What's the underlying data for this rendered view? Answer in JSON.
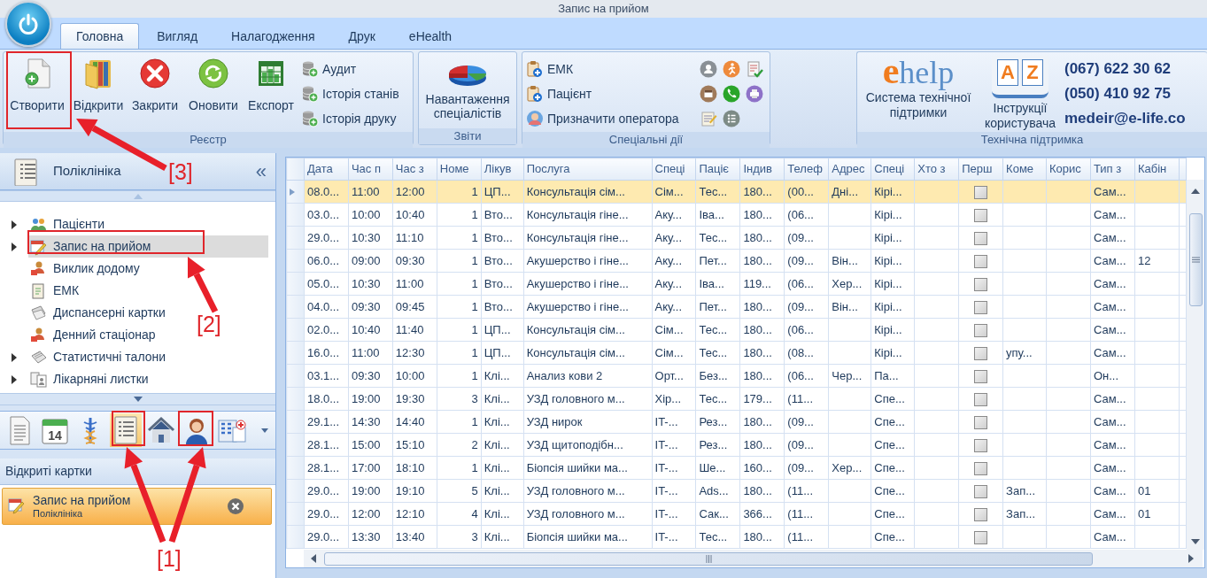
{
  "window": {
    "title": "Запис на прийом"
  },
  "tabs": [
    {
      "label": "Головна",
      "selected": true
    },
    {
      "label": "Вигляд",
      "selected": false
    },
    {
      "label": "Налагодження",
      "selected": false
    },
    {
      "label": "Друк",
      "selected": false
    },
    {
      "label": "eHealth",
      "selected": false
    }
  ],
  "ribbon": {
    "registry": {
      "caption": "Реєстр",
      "large_buttons": [
        "Створити",
        "Відкрити",
        "Закрити",
        "Оновити",
        "Експорт"
      ],
      "small_buttons": [
        "Аудит",
        "Історія станів",
        "Історія друку"
      ]
    },
    "reports": {
      "caption": "Звіти",
      "large_buttons": [
        "Навантаження спеціалістів"
      ]
    },
    "special_actions": {
      "caption": "Спеціальні дії",
      "small_buttons": [
        "ЕМК",
        "Пацієнт",
        "Призначити оператора"
      ]
    },
    "support": {
      "caption": "Технічна підтримка",
      "help_logo": "ehelp",
      "help_label": "Система технічної підтримки",
      "manual_letters": [
        "A",
        "Z"
      ],
      "manual_label": "Інструкції користувача",
      "contacts": [
        "(067) 622 30 62",
        "(050) 410 92 75",
        "medeir@e-life.co"
      ]
    }
  },
  "left_panel": {
    "title": "Поліклініка",
    "collapse": "«",
    "tree": [
      {
        "label": "Пацієнти",
        "expandable": true,
        "selected": false
      },
      {
        "label": "Запис на прийом",
        "expandable": true,
        "selected": true
      },
      {
        "label": "Виклик додому",
        "expandable": false,
        "selected": false
      },
      {
        "label": "ЕМК",
        "expandable": false,
        "selected": false
      },
      {
        "label": "Диспансерні картки",
        "expandable": false,
        "selected": false
      },
      {
        "label": "Денний стаціонар",
        "expandable": false,
        "selected": false
      },
      {
        "label": "Статистичні талони",
        "expandable": true,
        "selected": false
      },
      {
        "label": "Лікарняні листки",
        "expandable": true,
        "selected": false
      }
    ],
    "nav_icons": [
      {
        "selected": false
      },
      {
        "selected": false,
        "text": "14"
      },
      {
        "selected": false
      },
      {
        "selected": true
      },
      {
        "selected": false
      },
      {
        "selected": false
      },
      {
        "selected": false
      }
    ],
    "open_cards_title": "Відкриті картки",
    "open_cards": [
      {
        "title": "Запис на прийом",
        "subtitle": "Поліклініка"
      }
    ]
  },
  "grid": {
    "columns": [
      {
        "label": "Дата",
        "kind": "text"
      },
      {
        "label": "Час п",
        "kind": "text"
      },
      {
        "label": "Час з",
        "kind": "text"
      },
      {
        "label": "Номе",
        "kind": "number"
      },
      {
        "label": "Лікув",
        "kind": "text"
      },
      {
        "label": "Послуга",
        "kind": "text"
      },
      {
        "label": "Спеці",
        "kind": "text"
      },
      {
        "label": "Паціє",
        "kind": "text"
      },
      {
        "label": "Індив",
        "kind": "text"
      },
      {
        "label": "Телеф",
        "kind": "text"
      },
      {
        "label": "Адрес",
        "kind": "text"
      },
      {
        "label": "Спеці",
        "kind": "text"
      },
      {
        "label": "Хто з",
        "kind": "text"
      },
      {
        "label": "Перш",
        "kind": "check"
      },
      {
        "label": "Коме",
        "kind": "text"
      },
      {
        "label": "Корис",
        "kind": "text"
      },
      {
        "label": "Тип з",
        "kind": "text"
      },
      {
        "label": "Кабін",
        "kind": "text"
      }
    ],
    "rows": [
      {
        "selected": true,
        "checked": false,
        "cells": [
          "08.0...",
          "11:00",
          "12:00",
          "1",
          "ЦП...",
          "Консультація сім...",
          "Сім...",
          "Тес...",
          "180...",
          "(00...",
          "Дні...",
          "Кірі...",
          null,
          null,
          null,
          null,
          "Сам...",
          null
        ]
      },
      {
        "selected": false,
        "checked": false,
        "cells": [
          "03.0...",
          "10:00",
          "10:40",
          "1",
          "Вто...",
          "Консультація гіне...",
          "Аку...",
          "Іва...",
          "180...",
          "(06...",
          null,
          "Кірі...",
          null,
          null,
          null,
          null,
          "Сам...",
          null
        ]
      },
      {
        "selected": false,
        "checked": false,
        "cells": [
          "29.0...",
          "10:30",
          "11:10",
          "1",
          "Вто...",
          "Консультація гіне...",
          "Аку...",
          "Тес...",
          "180...",
          "(09...",
          null,
          "Кірі...",
          null,
          null,
          null,
          null,
          "Сам...",
          null
        ]
      },
      {
        "selected": false,
        "checked": false,
        "cells": [
          "06.0...",
          "09:00",
          "09:30",
          "1",
          "Вто...",
          "Акушерство і гіне...",
          "Аку...",
          "Пет...",
          "180...",
          "(09...",
          "Він...",
          "Кірі...",
          null,
          null,
          null,
          null,
          "Сам...",
          "12"
        ]
      },
      {
        "selected": false,
        "checked": false,
        "cells": [
          "05.0...",
          "10:30",
          "11:00",
          "1",
          "Вто...",
          "Акушерство і гіне...",
          "Аку...",
          "Іва...",
          "119...",
          "(06...",
          "Хер...",
          "Кірі...",
          null,
          null,
          null,
          null,
          "Сам...",
          null
        ]
      },
      {
        "selected": false,
        "checked": false,
        "cells": [
          "04.0...",
          "09:30",
          "09:45",
          "1",
          "Вто...",
          "Акушерство і гіне...",
          "Аку...",
          "Пет...",
          "180...",
          "(09...",
          "Він...",
          "Кірі...",
          null,
          null,
          null,
          null,
          "Сам...",
          null
        ]
      },
      {
        "selected": false,
        "checked": false,
        "cells": [
          "02.0...",
          "10:40",
          "11:40",
          "1",
          "ЦП...",
          "Консультація сім...",
          "Сім...",
          "Тес...",
          "180...",
          "(06...",
          null,
          "Кірі...",
          null,
          null,
          null,
          null,
          "Сам...",
          null
        ]
      },
      {
        "selected": false,
        "checked": false,
        "cells": [
          "16.0...",
          "11:00",
          "12:30",
          "1",
          "ЦП...",
          "Консультація сім...",
          "Сім...",
          "Тес...",
          "180...",
          "(08...",
          null,
          "Кірі...",
          null,
          null,
          "упу...",
          null,
          "Сам...",
          null
        ]
      },
      {
        "selected": false,
        "checked": false,
        "cells": [
          "03.1...",
          "09:30",
          "10:00",
          "1",
          "Клі...",
          "Анализ кови 2",
          "Орт...",
          "Без...",
          "180...",
          "(06...",
          "Чер...",
          "Па...",
          null,
          null,
          null,
          null,
          "Он...",
          null
        ]
      },
      {
        "selected": false,
        "checked": false,
        "cells": [
          "18.0...",
          "19:00",
          "19:30",
          "3",
          "Клі...",
          "УЗД головного м...",
          "Хір...",
          "Тес...",
          "179...",
          "(11...",
          null,
          "Спе...",
          null,
          null,
          null,
          null,
          "Сам...",
          null
        ]
      },
      {
        "selected": false,
        "checked": false,
        "cells": [
          "29.1...",
          "14:30",
          "14:40",
          "1",
          "Клі...",
          "УЗД нирок",
          "IT-...",
          "Рез...",
          "180...",
          "(09...",
          null,
          "Спе...",
          null,
          null,
          null,
          null,
          "Сам...",
          null
        ]
      },
      {
        "selected": false,
        "checked": false,
        "cells": [
          "28.1...",
          "15:00",
          "15:10",
          "2",
          "Клі...",
          "УЗД щитоподібн...",
          "IT-...",
          "Рез...",
          "180...",
          "(09...",
          null,
          "Спе...",
          null,
          null,
          null,
          null,
          "Сам...",
          null
        ]
      },
      {
        "selected": false,
        "checked": false,
        "cells": [
          "28.1...",
          "17:00",
          "18:10",
          "1",
          "Клі...",
          "Біопсія шийки ма...",
          "IT-...",
          "Ше...",
          "160...",
          "(09...",
          "Хер...",
          "Спе...",
          null,
          null,
          null,
          null,
          "Сам...",
          null
        ]
      },
      {
        "selected": false,
        "checked": false,
        "cells": [
          "29.0...",
          "19:00",
          "19:10",
          "5",
          "Клі...",
          "УЗД головного м...",
          "IT-...",
          "Ads...",
          "180...",
          "(11...",
          null,
          "Спе...",
          null,
          null,
          "Зап...",
          null,
          "Сам...",
          "01"
        ]
      },
      {
        "selected": false,
        "checked": false,
        "cells": [
          "29.0...",
          "12:00",
          "12:10",
          "4",
          "Клі...",
          "УЗД головного м...",
          "IT-...",
          "Сак...",
          "366...",
          "(11...",
          null,
          "Спе...",
          null,
          null,
          "Зап...",
          null,
          "Сам...",
          "01"
        ]
      },
      {
        "selected": false,
        "checked": false,
        "cells": [
          "29.0...",
          "13:30",
          "13:40",
          "3",
          "Клі...",
          "Біопсія шийки ма...",
          "IT-...",
          "Тес...",
          "180...",
          "(11...",
          null,
          "Спе...",
          null,
          null,
          null,
          null,
          "Сам...",
          null
        ]
      }
    ]
  },
  "annotations": [
    {
      "label": "[3]"
    },
    {
      "label": "[2]"
    },
    {
      "label": "[1]"
    }
  ]
}
